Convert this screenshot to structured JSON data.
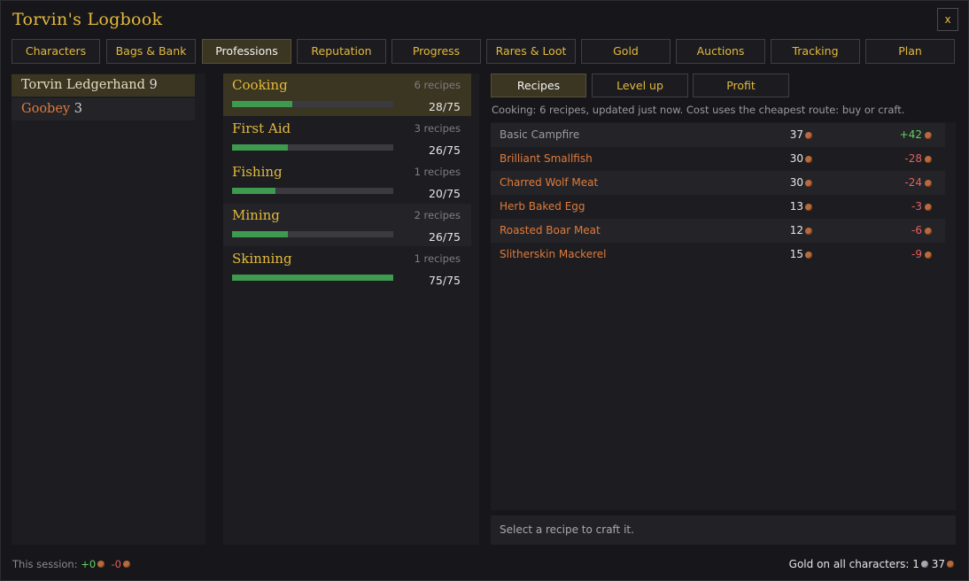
{
  "window": {
    "title": "Torvin's Logbook",
    "close_label": "x"
  },
  "tabs": [
    {
      "label": "Characters",
      "active": false
    },
    {
      "label": "Bags & Bank",
      "active": false
    },
    {
      "label": "Professions",
      "active": true
    },
    {
      "label": "Reputation",
      "active": false
    },
    {
      "label": "Progress",
      "active": false
    },
    {
      "label": "Rares & Loot",
      "active": false
    },
    {
      "label": "Gold",
      "active": false
    },
    {
      "label": "Auctions",
      "active": false
    },
    {
      "label": "Tracking",
      "active": false
    },
    {
      "label": "Plan",
      "active": false
    }
  ],
  "characters": [
    {
      "name": "Torvin Ledgerhand",
      "level": "9",
      "selected": true
    },
    {
      "name": "Goobey",
      "level": "3",
      "selected": false
    }
  ],
  "professions": [
    {
      "name": "Cooking",
      "recipes": "6 recipes",
      "skill": "28/75",
      "progress": 0.373,
      "selected": true
    },
    {
      "name": "First Aid",
      "recipes": "3 recipes",
      "skill": "26/75",
      "progress": 0.347,
      "selected": false
    },
    {
      "name": "Fishing",
      "recipes": "1 recipes",
      "skill": "20/75",
      "progress": 0.267,
      "selected": false
    },
    {
      "name": "Mining",
      "recipes": "2 recipes",
      "skill": "26/75",
      "progress": 0.347,
      "selected": false
    },
    {
      "name": "Skinning",
      "recipes": "1 recipes",
      "skill": "75/75",
      "progress": 1.0,
      "selected": false
    }
  ],
  "subtabs": [
    {
      "label": "Recipes",
      "active": true
    },
    {
      "label": "Level up",
      "active": false
    },
    {
      "label": "Profit",
      "active": false
    }
  ],
  "info_text": "Cooking: 6 recipes, updated just now. Cost uses the cheapest route: buy or craft.",
  "recipes": [
    {
      "name": "Basic Campfire",
      "cost": "37",
      "profit": "+42",
      "color": "gray",
      "profit_sign": "pos"
    },
    {
      "name": "Brilliant Smallfish",
      "cost": "30",
      "profit": "-28",
      "color": "orange",
      "profit_sign": "neg"
    },
    {
      "name": "Charred Wolf Meat",
      "cost": "30",
      "profit": "-24",
      "color": "orange",
      "profit_sign": "neg"
    },
    {
      "name": "Herb Baked Egg",
      "cost": "13",
      "profit": "-3",
      "color": "orange",
      "profit_sign": "neg"
    },
    {
      "name": "Roasted Boar Meat",
      "cost": "12",
      "profit": "-6",
      "color": "orange",
      "profit_sign": "neg"
    },
    {
      "name": "Slitherskin Mackerel",
      "cost": "15",
      "profit": "-9",
      "color": "orange",
      "profit_sign": "neg"
    }
  ],
  "hint": "Select a recipe to craft it.",
  "footer": {
    "session_label": "This session:",
    "session_gain": "+0",
    "session_loss": "-0",
    "gold_label": "Gold on all characters:",
    "gold_silver": "1",
    "gold_copper": "37"
  },
  "colors": {
    "accent_gold": "#e3b93c",
    "selected_bg": "#3b3622",
    "progress_green": "#3d9a4e",
    "profit_positive": "#5fd15f",
    "profit_negative": "#e06060",
    "item_orange": "#e07a3a",
    "copper_coin": "#b86a3a",
    "silver_coin": "#a8a8b0"
  }
}
